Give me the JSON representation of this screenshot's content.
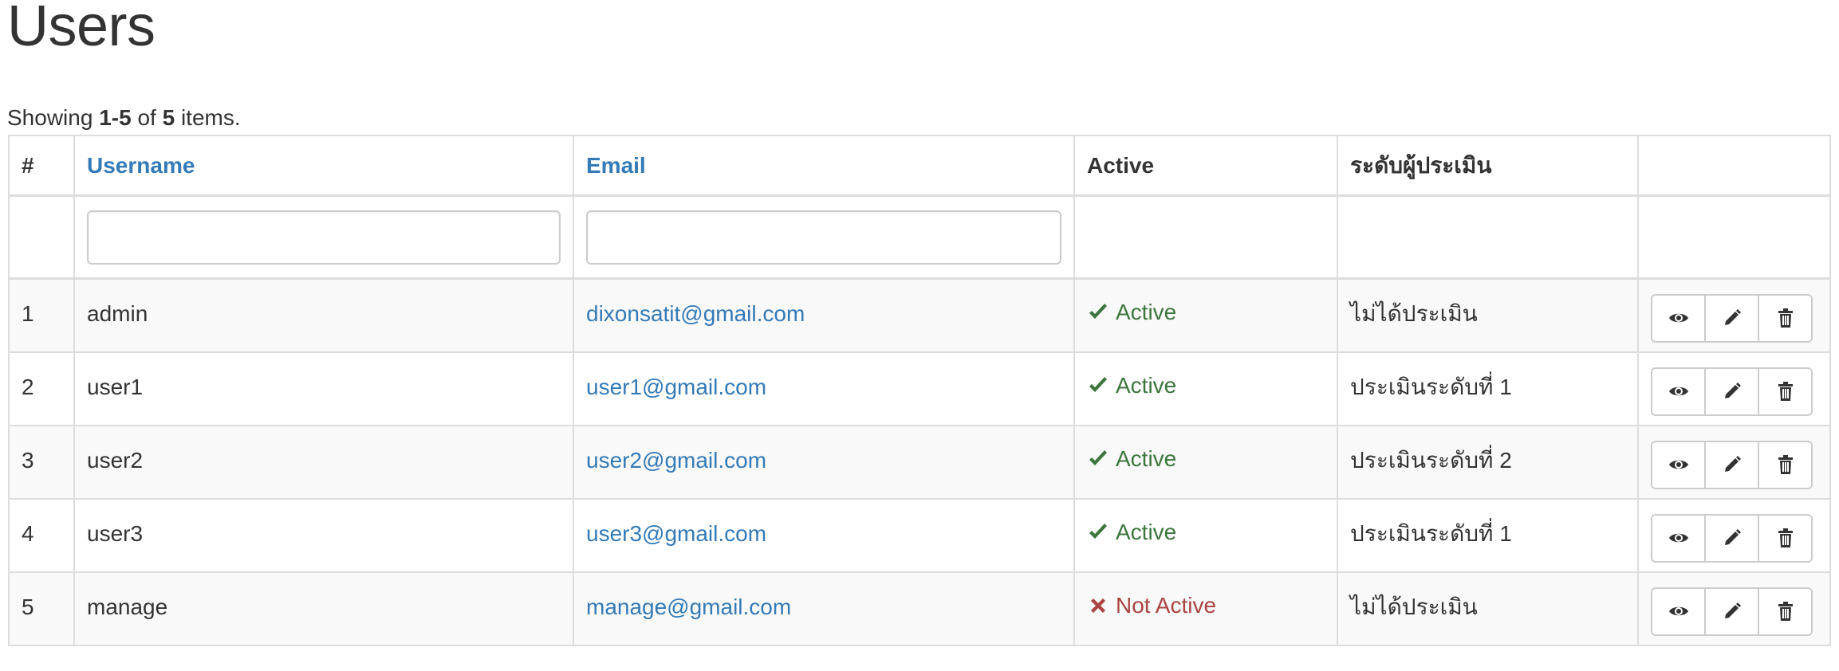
{
  "page": {
    "title": "Users"
  },
  "summary": {
    "prefix": "Showing",
    "range": "1-5",
    "middle": "of",
    "total": "5",
    "suffix": "items."
  },
  "table": {
    "columns": {
      "num": "#",
      "username": "Username",
      "email": "Email",
      "active": "Active",
      "level": "ระดับผู้ประเมิน",
      "actions": ""
    },
    "filters": {
      "username_value": "",
      "email_value": ""
    },
    "rows": [
      {
        "num": "1",
        "username": "admin",
        "email": "dixonsatit@gmail.com",
        "status": "Active",
        "status_type": "active",
        "level": "ไม่ได้ประเมิน"
      },
      {
        "num": "2",
        "username": "user1",
        "email": "user1@gmail.com",
        "status": "Active",
        "status_type": "active",
        "level": "ประเมินระดับที่ 1"
      },
      {
        "num": "3",
        "username": "user2",
        "email": "user2@gmail.com",
        "status": "Active",
        "status_type": "active",
        "level": "ประเมินระดับที่ 2"
      },
      {
        "num": "4",
        "username": "user3",
        "email": "user3@gmail.com",
        "status": "Active",
        "status_type": "active",
        "level": "ประเมินระดับที่ 1"
      },
      {
        "num": "5",
        "username": "manage",
        "email": "manage@gmail.com",
        "status": "Not Active",
        "status_type": "inactive",
        "level": "ไม่ได้ประเมิน"
      }
    ],
    "action_icons": [
      "eye-icon",
      "pencil-icon",
      "trash-icon"
    ]
  },
  "colors": {
    "link": "#337ab7",
    "active": "#3c763d",
    "inactive": "#a94442",
    "border": "#dddddd",
    "stripe": "#f9f9f9"
  }
}
